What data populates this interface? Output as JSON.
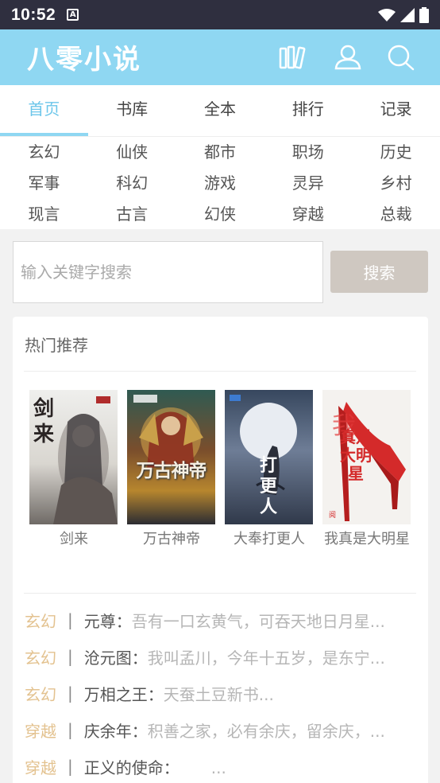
{
  "status_bar": {
    "time": "10:52",
    "app_icon_letter": "A"
  },
  "header": {
    "logo": "八零小说"
  },
  "nav": {
    "tabs": [
      {
        "label": "首页"
      },
      {
        "label": "书库"
      },
      {
        "label": "全本"
      },
      {
        "label": "排行"
      },
      {
        "label": "记录"
      }
    ],
    "active_index": 0
  },
  "genres": [
    "玄幻",
    "仙侠",
    "都市",
    "职场",
    "历史",
    "军事",
    "科幻",
    "游戏",
    "灵异",
    "乡村",
    "现言",
    "古言",
    "幻侠",
    "穿越",
    "总裁"
  ],
  "search": {
    "placeholder": "输入关键字搜索",
    "button_label": "搜索"
  },
  "hot": {
    "title": "热门推荐",
    "books": [
      {
        "title": "剑来",
        "cover_text": "剑来"
      },
      {
        "title": "万古神帝",
        "cover_text": "万古神帝"
      },
      {
        "title": "大奉打更人",
        "cover_text": "打更人"
      },
      {
        "title": "我真是大明星",
        "cover_text": "真是大明星"
      }
    ]
  },
  "recommendations": [
    {
      "genre": "玄幻",
      "sep": "|",
      "name": "元尊：",
      "desc": "吾有一口玄黄气，可吞天地日月星..."
    },
    {
      "genre": "玄幻",
      "sep": "|",
      "name": "沧元图：",
      "desc": "我叫孟川，今年十五岁，是东宁..."
    },
    {
      "genre": "玄幻",
      "sep": "|",
      "name": "万相之王：",
      "desc": "天蚕土豆新书..."
    },
    {
      "genre": "穿越",
      "sep": "|",
      "name": "庆余年：",
      "desc": "积善之家，必有余庆，留余庆，..."
    },
    {
      "genre": "穿越",
      "sep": "|",
      "name": "正义的使命：",
      "desc": "　　..."
    }
  ],
  "colors": {
    "accent": "#8fd7f2",
    "active_tab": "#6cc6ea",
    "genre_tag": "#e3c28f",
    "search_button": "#cfc8c1"
  }
}
